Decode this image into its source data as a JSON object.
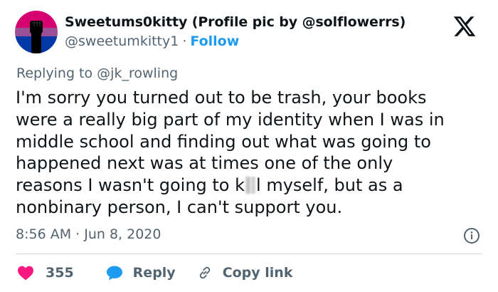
{
  "user": {
    "display_name": "Sweetums0kitty (Profile pic by @solflowerrs)",
    "handle": "@sweetumkitty1",
    "separator": "·",
    "follow_label": "Follow",
    "avatar_icon": "raised-fist-bisexual-flag-avatar"
  },
  "header": {
    "logo_icon": "x-logo-icon"
  },
  "reply_context": {
    "prefix": "Replying to",
    "mention": "@jk_rowling"
  },
  "tweet": {
    "lines": [
      "I'm sorry you turned out to be trash, your books",
      "were a really big part of my identity when I was in",
      "middle school and finding out what was going to",
      "happened next was at times one of the only"
    ],
    "line5_before": "reasons I wasn't going to k",
    "line5_after": "l myself, but as a",
    "line6": "nonbinary person, I can't support you."
  },
  "meta": {
    "timestamp": "8:56 AM · Jun 8, 2020",
    "info_icon": "info-icon"
  },
  "actions": {
    "like_count": "355",
    "reply_label": "Reply",
    "copy_link_label": "Copy link"
  },
  "colors": {
    "accent": "#1d9bf0",
    "like": "#f91880",
    "text": "#0f1419",
    "secondary": "#536471",
    "divider": "#cfd9de",
    "flag_pink": "#d60270",
    "flag_purple": "#9b4f96",
    "flag_blue": "#0038a8"
  }
}
